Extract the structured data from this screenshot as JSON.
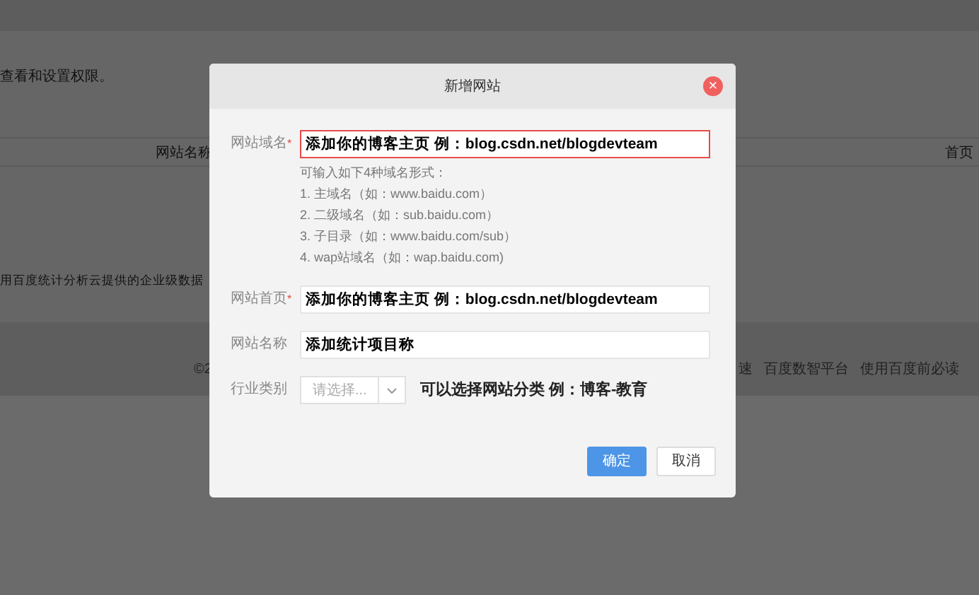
{
  "background": {
    "notice": "查看和设置权限。",
    "table_header": [
      "网站名称",
      "首页"
    ],
    "description": "用百度统计分析云提供的企业级数据",
    "footer": {
      "left": "©2",
      "links": [
        "速",
        "百度数智平台",
        "使用百度前必读"
      ]
    }
  },
  "dialog": {
    "title": "新增网站",
    "close": "×",
    "required_mark": "*",
    "fields": [
      {
        "kind": "input",
        "label": "网站域名",
        "required": true,
        "invalid": true,
        "value": "添加你的博客主页 例：blog.csdn.net/blogdevteam",
        "help": [
          "可输入如下4种域名形式：",
          "1. 主域名（如：www.baidu.com）",
          "2. 二级域名（如：sub.baidu.com）",
          "3. 子目录（如：www.baidu.com/sub）",
          "4. wap站域名（如：wap.baidu.com)"
        ]
      },
      {
        "kind": "input",
        "label": "网站首页",
        "required": true,
        "invalid": false,
        "value": "添加你的博客主页 例：blog.csdn.net/blogdevteam"
      },
      {
        "kind": "input",
        "label": "网站名称",
        "required": false,
        "invalid": false,
        "value": "添加统计项目称"
      },
      {
        "kind": "select",
        "label": "行业类别",
        "required": false,
        "placeholder": "请选择...",
        "note": "可以选择网站分类 例：博客-教育"
      }
    ],
    "buttons": [
      {
        "label": "确定",
        "primary": true
      },
      {
        "label": "取消",
        "primary": false
      }
    ]
  }
}
